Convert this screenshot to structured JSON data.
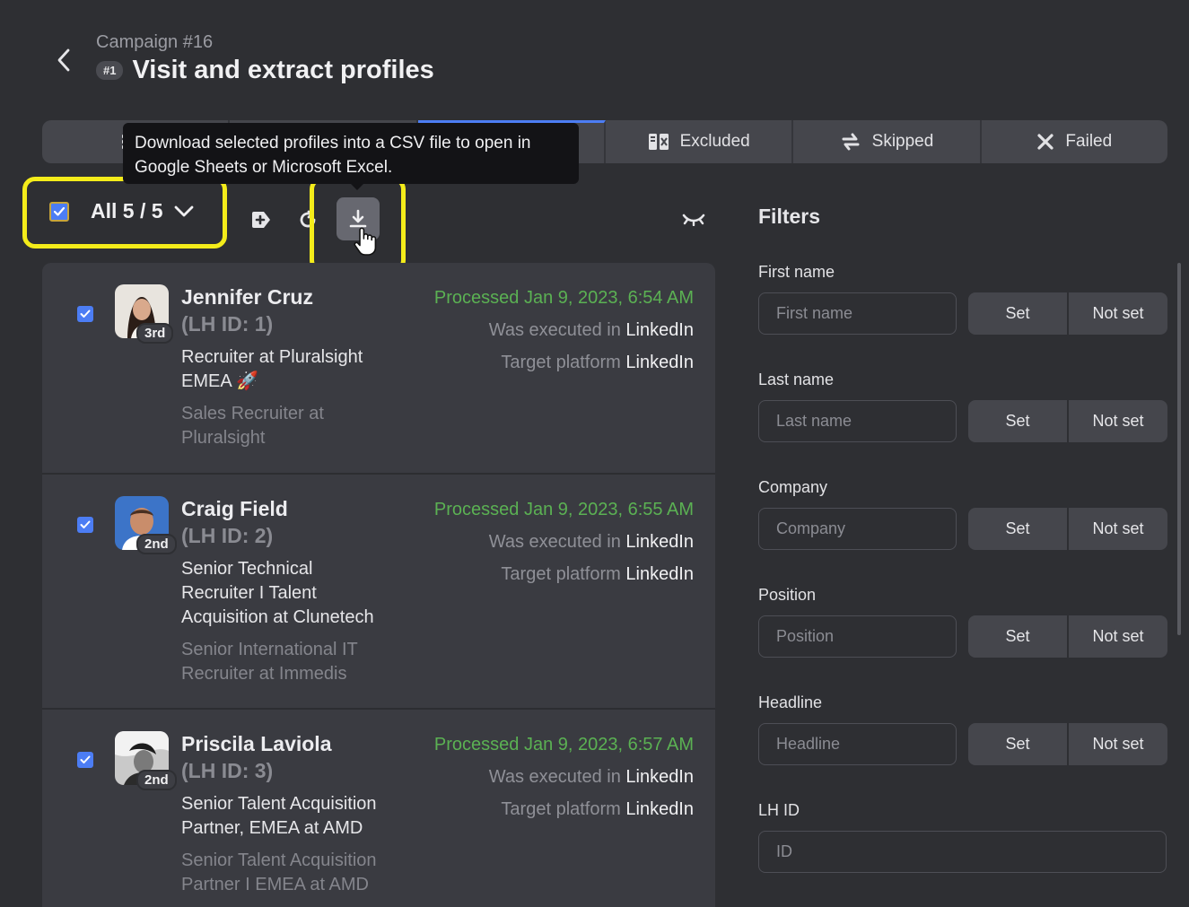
{
  "header": {
    "campaign": "Campaign #16",
    "step_badge": "#1",
    "title": "Visit and extract profiles"
  },
  "tabs": [
    {
      "label": "",
      "icon": "queue-icon"
    },
    {
      "label": "",
      "icon": "tab-icon"
    },
    {
      "label": "",
      "icon": "tab-icon",
      "active": true
    },
    {
      "label": "Excluded",
      "icon": "excluded-icon"
    },
    {
      "label": "Skipped",
      "icon": "skipped-icon"
    },
    {
      "label": "Failed",
      "icon": "failed-icon"
    }
  ],
  "tooltip": {
    "line1": "Download selected profiles into a CSV file to open in",
    "line2": "Google Sheets or Microsoft Excel."
  },
  "toolbar": {
    "selection_label": "All 5 / 5"
  },
  "profiles": [
    {
      "name": "Jennifer Cruz",
      "lh_id": "(LH ID: 1)",
      "degree": "3rd",
      "headline_1": "Recruiter at Pluralsight",
      "headline_2": "EMEA 🚀",
      "position_1": "Sales Recruiter at",
      "position_2": "Pluralsight",
      "processed": "Processed Jan 9, 2023, 6:54 AM",
      "executed_prefix": "Was executed in ",
      "executed_in": "LinkedIn",
      "target_prefix": "Target platform ",
      "target_platform": "LinkedIn"
    },
    {
      "name": "Craig Field",
      "lh_id": "(LH ID: 2)",
      "degree": "2nd",
      "headline_1": "Senior Technical",
      "headline_2": "Recruiter I Talent",
      "headline_3": "Acquisition at Clunetech",
      "position_1": "Senior International IT",
      "position_2": "Recruiter at Immedis",
      "processed": "Processed Jan 9, 2023, 6:55 AM",
      "executed_prefix": "Was executed in ",
      "executed_in": "LinkedIn",
      "target_prefix": "Target platform ",
      "target_platform": "LinkedIn"
    },
    {
      "name": "Priscila Laviola",
      "lh_id": "(LH ID: 3)",
      "degree": "2nd",
      "headline_1": "Senior Talent Acquisition",
      "headline_2": "Partner, EMEA at AMD",
      "position_1": "Senior Talent Acquisition",
      "position_2": "Partner I EMEA at AMD",
      "processed": "Processed Jan 9, 2023, 6:57 AM",
      "executed_prefix": "Was executed in ",
      "executed_in": "LinkedIn",
      "target_prefix": "Target platform ",
      "target_platform": "LinkedIn"
    }
  ],
  "filters": {
    "title": "Filters",
    "set_label": "Set",
    "not_set_label": "Not set",
    "fields": [
      {
        "label": "First name",
        "placeholder": "First name"
      },
      {
        "label": "Last name",
        "placeholder": "Last name"
      },
      {
        "label": "Company",
        "placeholder": "Company"
      },
      {
        "label": "Position",
        "placeholder": "Position"
      },
      {
        "label": "Headline",
        "placeholder": "Headline"
      },
      {
        "label": "LH ID",
        "placeholder": "ID"
      }
    ]
  },
  "colors": {
    "accent": "#4c7df4",
    "processed": "#5bb153",
    "highlight": "#f4ec1a",
    "background": "#2e2f33"
  }
}
